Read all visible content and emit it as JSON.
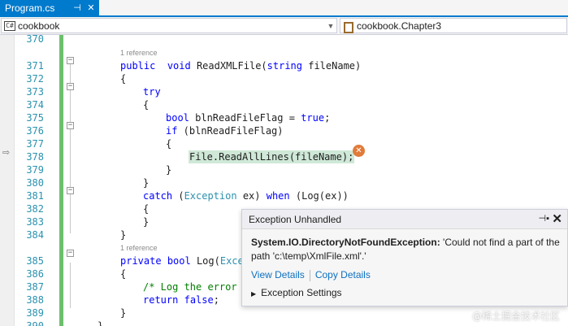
{
  "tab": {
    "title": "Program.cs",
    "pin_icon": "pin-icon",
    "close_icon": "close-icon"
  },
  "nav": {
    "project": "cookbook",
    "namespace": "cookbook.Chapter3",
    "project_icon_text": "C#"
  },
  "code": {
    "lines": [
      {
        "n": "370",
        "parts": []
      },
      {
        "ref": "1 reference"
      },
      {
        "n": "371",
        "parts": [
          [
            "kw",
            "public"
          ],
          [
            "",
            "  "
          ],
          [
            "kw",
            "void"
          ],
          [
            "",
            " ReadXMLFile("
          ],
          [
            "kw",
            "string"
          ],
          [
            "",
            " fileName)"
          ]
        ]
      },
      {
        "n": "372",
        "parts": [
          [
            "",
            "{"
          ]
        ]
      },
      {
        "n": "373",
        "parts": [
          [
            "kw",
            "try"
          ]
        ]
      },
      {
        "n": "374",
        "parts": [
          [
            "",
            "{"
          ]
        ]
      },
      {
        "n": "375",
        "parts": [
          [
            "kw",
            "bool"
          ],
          [
            "",
            " blnReadFileFlag = "
          ],
          [
            "kw",
            "true"
          ],
          [
            "",
            ";"
          ]
        ]
      },
      {
        "n": "376",
        "parts": [
          [
            "kw",
            "if"
          ],
          [
            "",
            " (blnReadFileFlag)"
          ]
        ]
      },
      {
        "n": "377",
        "parts": [
          [
            "",
            "{"
          ]
        ]
      },
      {
        "n": "378",
        "parts": [
          [
            "hl",
            "File.ReadAllLines(fileName);"
          ]
        ]
      },
      {
        "n": "379",
        "parts": [
          [
            "",
            "}"
          ]
        ]
      },
      {
        "n": "380",
        "parts": [
          [
            "",
            "}"
          ]
        ]
      },
      {
        "n": "381",
        "parts": [
          [
            "kw",
            "catch"
          ],
          [
            "",
            " ("
          ],
          [
            "ty",
            "Exception"
          ],
          [
            "",
            " ex) "
          ],
          [
            "kw",
            "when"
          ],
          [
            "",
            " (Log(ex))"
          ]
        ]
      },
      {
        "n": "382",
        "parts": [
          [
            "",
            "{"
          ]
        ]
      },
      {
        "n": "383",
        "parts": [
          [
            "",
            "}"
          ]
        ]
      },
      {
        "n": "384",
        "parts": [
          [
            "",
            "}"
          ]
        ]
      },
      {
        "ref": "1 reference"
      },
      {
        "n": "385",
        "parts": [
          [
            "kw",
            "private"
          ],
          [
            "",
            " "
          ],
          [
            "kw",
            "bool"
          ],
          [
            "",
            " Log("
          ],
          [
            "ty",
            "Excep"
          ]
        ]
      },
      {
        "n": "386",
        "parts": [
          [
            "",
            "{"
          ]
        ]
      },
      {
        "n": "387",
        "parts": [
          [
            "cm",
            "/* Log the error"
          ]
        ]
      },
      {
        "n": "388",
        "parts": [
          [
            "kw",
            "return"
          ],
          [
            "",
            " "
          ],
          [
            "kw",
            "false"
          ],
          [
            "",
            ";"
          ]
        ]
      },
      {
        "n": "389",
        "parts": [
          [
            "",
            "}"
          ]
        ]
      },
      {
        "n": "390",
        "parts": [
          [
            "",
            "}"
          ]
        ]
      }
    ]
  },
  "exception": {
    "title": "Exception Unhandled",
    "type": "System.IO.DirectoryNotFoundException:",
    "message": " 'Could not find a part of the path 'c:\\temp\\XmlFile.xml'.'",
    "view_details": "View Details",
    "copy_details": "Copy Details",
    "settings": "Exception Settings"
  },
  "watermark": "@稀土掘金技术社区",
  "colors": {
    "accent": "#007acc",
    "keyword": "#0000ff",
    "type": "#2b91af",
    "comment": "#008000",
    "change_bar": "#6cc06c",
    "error_icon": "#e07b3a"
  }
}
